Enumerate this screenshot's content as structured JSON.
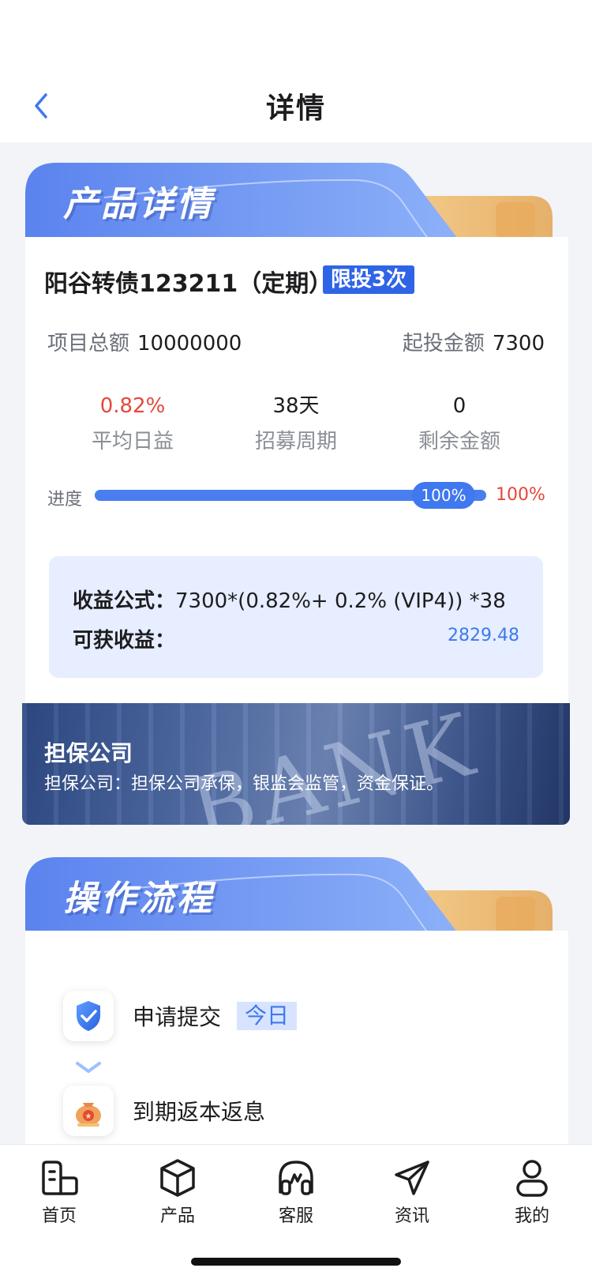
{
  "nav": {
    "title": "详情"
  },
  "product_section": {
    "header": "产品详情",
    "name": "阳谷转债123211（定期）",
    "limit_badge": "限投3次",
    "total_label": "项目总额",
    "total_value": "10000000",
    "min_label": "起投金额",
    "min_value": "7300",
    "stats": [
      {
        "value": "0.82%",
        "caption": "平均日益"
      },
      {
        "value": "38天",
        "caption": "招募周期"
      },
      {
        "value": "0",
        "caption": "剩余金额"
      }
    ],
    "progress": {
      "label": "进度",
      "bubble": "100%",
      "percent_text": "100%",
      "fraction": 1.0
    },
    "formula_label": "收益公式：",
    "formula_value": "7300*(0.82%+ 0.2% (VIP4)) *38",
    "gain_label": "可获收益：",
    "gain_value": "2829.48"
  },
  "guarantee": {
    "title": "担保公司",
    "desc": "担保公司：担保公司承保，银监会监管，资金保证。",
    "image_text": "BANK"
  },
  "process_section": {
    "header": "操作流程",
    "steps": [
      {
        "label": "申请提交",
        "tag": "今日",
        "icon": "shield-check-icon"
      },
      {
        "label": "到期返本返息",
        "icon": "money-bag-icon"
      }
    ]
  },
  "tabs": [
    {
      "label": "首页",
      "icon": "home-icon"
    },
    {
      "label": "产品",
      "icon": "cube-icon"
    },
    {
      "label": "客服",
      "icon": "headset-icon"
    },
    {
      "label": "资讯",
      "icon": "paper-plane-icon"
    },
    {
      "label": "我的",
      "icon": "person-icon"
    }
  ],
  "colors": {
    "accent": "#3f78ef",
    "red": "#e5483a",
    "banner_gold": "#eec078"
  }
}
